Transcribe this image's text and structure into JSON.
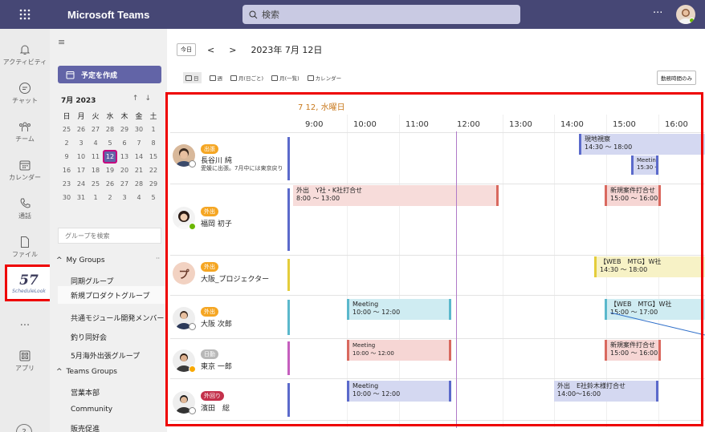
{
  "app": {
    "title": "Microsoft Teams"
  },
  "search": {
    "placeholder": "検索"
  },
  "rail": {
    "items": [
      {
        "label": "アクティビティ",
        "icon": "bell-icon"
      },
      {
        "label": "チャット",
        "icon": "chat-icon"
      },
      {
        "label": "チーム",
        "icon": "teams-icon"
      },
      {
        "label": "カレンダー",
        "icon": "calendar-icon"
      },
      {
        "label": "通話",
        "icon": "phone-icon"
      },
      {
        "label": "ファイル",
        "icon": "file-icon"
      },
      {
        "label": "ScheduleLook",
        "icon": "schedulelook-logo"
      },
      {
        "label": "アプリ",
        "icon": "apps-icon"
      }
    ],
    "more": "...",
    "help": "?"
  },
  "nav": {
    "create_button": "予定を作成",
    "month": "7月 2023",
    "calendar": {
      "dow": [
        "日",
        "月",
        "火",
        "水",
        "木",
        "金",
        "土"
      ],
      "weeks": [
        [
          "25",
          "26",
          "27",
          "28",
          "29",
          "30",
          "1"
        ],
        [
          "2",
          "3",
          "4",
          "5",
          "6",
          "7",
          "8"
        ],
        [
          "9",
          "10",
          "11",
          "12",
          "13",
          "14",
          "15"
        ],
        [
          "16",
          "17",
          "18",
          "19",
          "20",
          "21",
          "22"
        ],
        [
          "23",
          "24",
          "25",
          "26",
          "27",
          "28",
          "29"
        ],
        [
          "30",
          "31",
          "1",
          "2",
          "3",
          "4",
          "5"
        ]
      ],
      "today": "12"
    },
    "group_search_placeholder": "グループを検索",
    "my_groups": {
      "label": "My Groups",
      "items": [
        "同期グループ",
        "新規プロダクトグループ",
        "共通モジュール開発メンバー",
        "釣り同好会",
        "5月海外出張グループ"
      ]
    },
    "teams_groups": {
      "label": "Teams Groups",
      "items": [
        "営業本部",
        "Community",
        "販売促進"
      ]
    }
  },
  "toolbar": {
    "today": "今日",
    "date": "2023年 7月 12日",
    "views": [
      "日",
      "週",
      "月(日ごと)",
      "月(一覧)",
      "カレンダー"
    ],
    "worktime_only": "勤務時間のみ"
  },
  "schedule": {
    "date_header": "7 12, 水曜日",
    "hours": [
      "9:00",
      "10:00",
      "11:00",
      "12:00",
      "13:00",
      "14:00",
      "15:00",
      "16:00"
    ],
    "people": [
      {
        "name": "長谷川 純",
        "badge": "出張",
        "badge_color": "#f5a623",
        "note": "愛媛に出張。7月中には東京戻り",
        "status": "offline",
        "events": [
          {
            "title": "現地視察",
            "time": "14:30 ～ 18:00",
            "color": "blue"
          },
          {
            "title": "Meeting",
            "time": "15:30 ～",
            "color": "blue"
          }
        ]
      },
      {
        "name": "福岡 初子",
        "badge": "外出",
        "badge_color": "#f5a623",
        "note": "",
        "status": "available",
        "events": [
          {
            "title": "外出　Y社・K社打合せ",
            "time": "8:00 ～ 13:00",
            "color": "red"
          },
          {
            "title": "新規案件打合せ",
            "time": "15:00 ～ 16:00",
            "color": "red"
          }
        ]
      },
      {
        "name": "大阪_プロジェクター",
        "badge": "外出",
        "badge_color": "#f5a623",
        "note": "",
        "initial": "プ",
        "events": [
          {
            "title": "【WEB　MTG】W社",
            "time": "14:30 ～ 18:00",
            "color": "yellow"
          }
        ]
      },
      {
        "name": "大阪 次郎",
        "badge": "外出",
        "badge_color": "#f5a623",
        "note": "",
        "status": "offline",
        "events": [
          {
            "title": "Meeting",
            "time": "10:00 ～ 12:00",
            "color": "cyan"
          },
          {
            "title": "【WEB　MTG】W社",
            "time": "15:00 ～ 17:00",
            "color": "cyan"
          }
        ]
      },
      {
        "name": "東京 一郎",
        "badge": "日勤",
        "badge_color": "#b8b8b8",
        "note": "",
        "status": "away",
        "events": [
          {
            "title": "Meeting",
            "time": "10:00 ～ 12:00",
            "color": "red"
          },
          {
            "title": "新規案件打合せ",
            "time": "15:00 ～ 16:00",
            "color": "red"
          }
        ]
      },
      {
        "name": "濱田　総",
        "badge": "外回り",
        "badge_color": "#c4314b",
        "note": "",
        "status": "offline",
        "events": [
          {
            "title": "Meeting",
            "time": "10:00 ～ 12:00",
            "color": "blue"
          },
          {
            "title": "外出　E社鈴木様打合せ",
            "time": "14:00～16:00",
            "color": "blue"
          }
        ]
      }
    ]
  }
}
